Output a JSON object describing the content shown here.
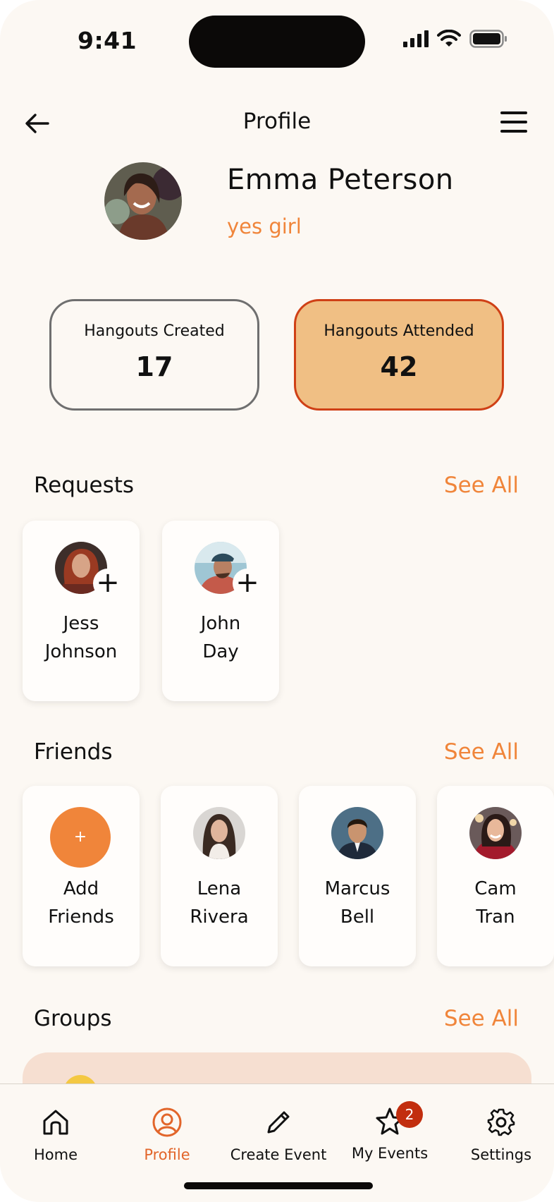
{
  "status_bar": {
    "time": "9:41"
  },
  "header": {
    "title": "Profile"
  },
  "profile": {
    "name": "Emma Peterson",
    "bio": "yes girl"
  },
  "stats": [
    {
      "label": "Hangouts Created",
      "value": "17"
    },
    {
      "label": "Hangouts Attended",
      "value": "42"
    }
  ],
  "requests": {
    "title": "Requests",
    "see_all": "See All",
    "items": [
      {
        "first": "Jess",
        "last": "Johnson"
      },
      {
        "first": "John",
        "last": "Day"
      }
    ]
  },
  "friends": {
    "title": "Friends",
    "see_all": "See All",
    "add": {
      "symbol": "+",
      "first": "Add",
      "last": "Friends"
    },
    "items": [
      {
        "first": "Lena",
        "last": "Rivera"
      },
      {
        "first": "Marcus",
        "last": "Bell"
      },
      {
        "first": "Cam",
        "last": "Tran"
      }
    ]
  },
  "groups": {
    "title": "Groups",
    "see_all": "See All"
  },
  "tabbar": {
    "items": [
      {
        "label": "Home",
        "icon": "home-icon"
      },
      {
        "label": "Profile",
        "icon": "profile-icon"
      },
      {
        "label": "Create Event",
        "icon": "pencil-icon"
      },
      {
        "label": "My Events",
        "icon": "star-icon",
        "badge": "2"
      },
      {
        "label": "Settings",
        "icon": "gear-icon"
      }
    ]
  },
  "colors": {
    "accent": "#f0853a",
    "attended_fill": "#f0bf84",
    "attended_border": "#cf4016",
    "background": "#fcf8f3",
    "badge": "#c22e0e"
  }
}
